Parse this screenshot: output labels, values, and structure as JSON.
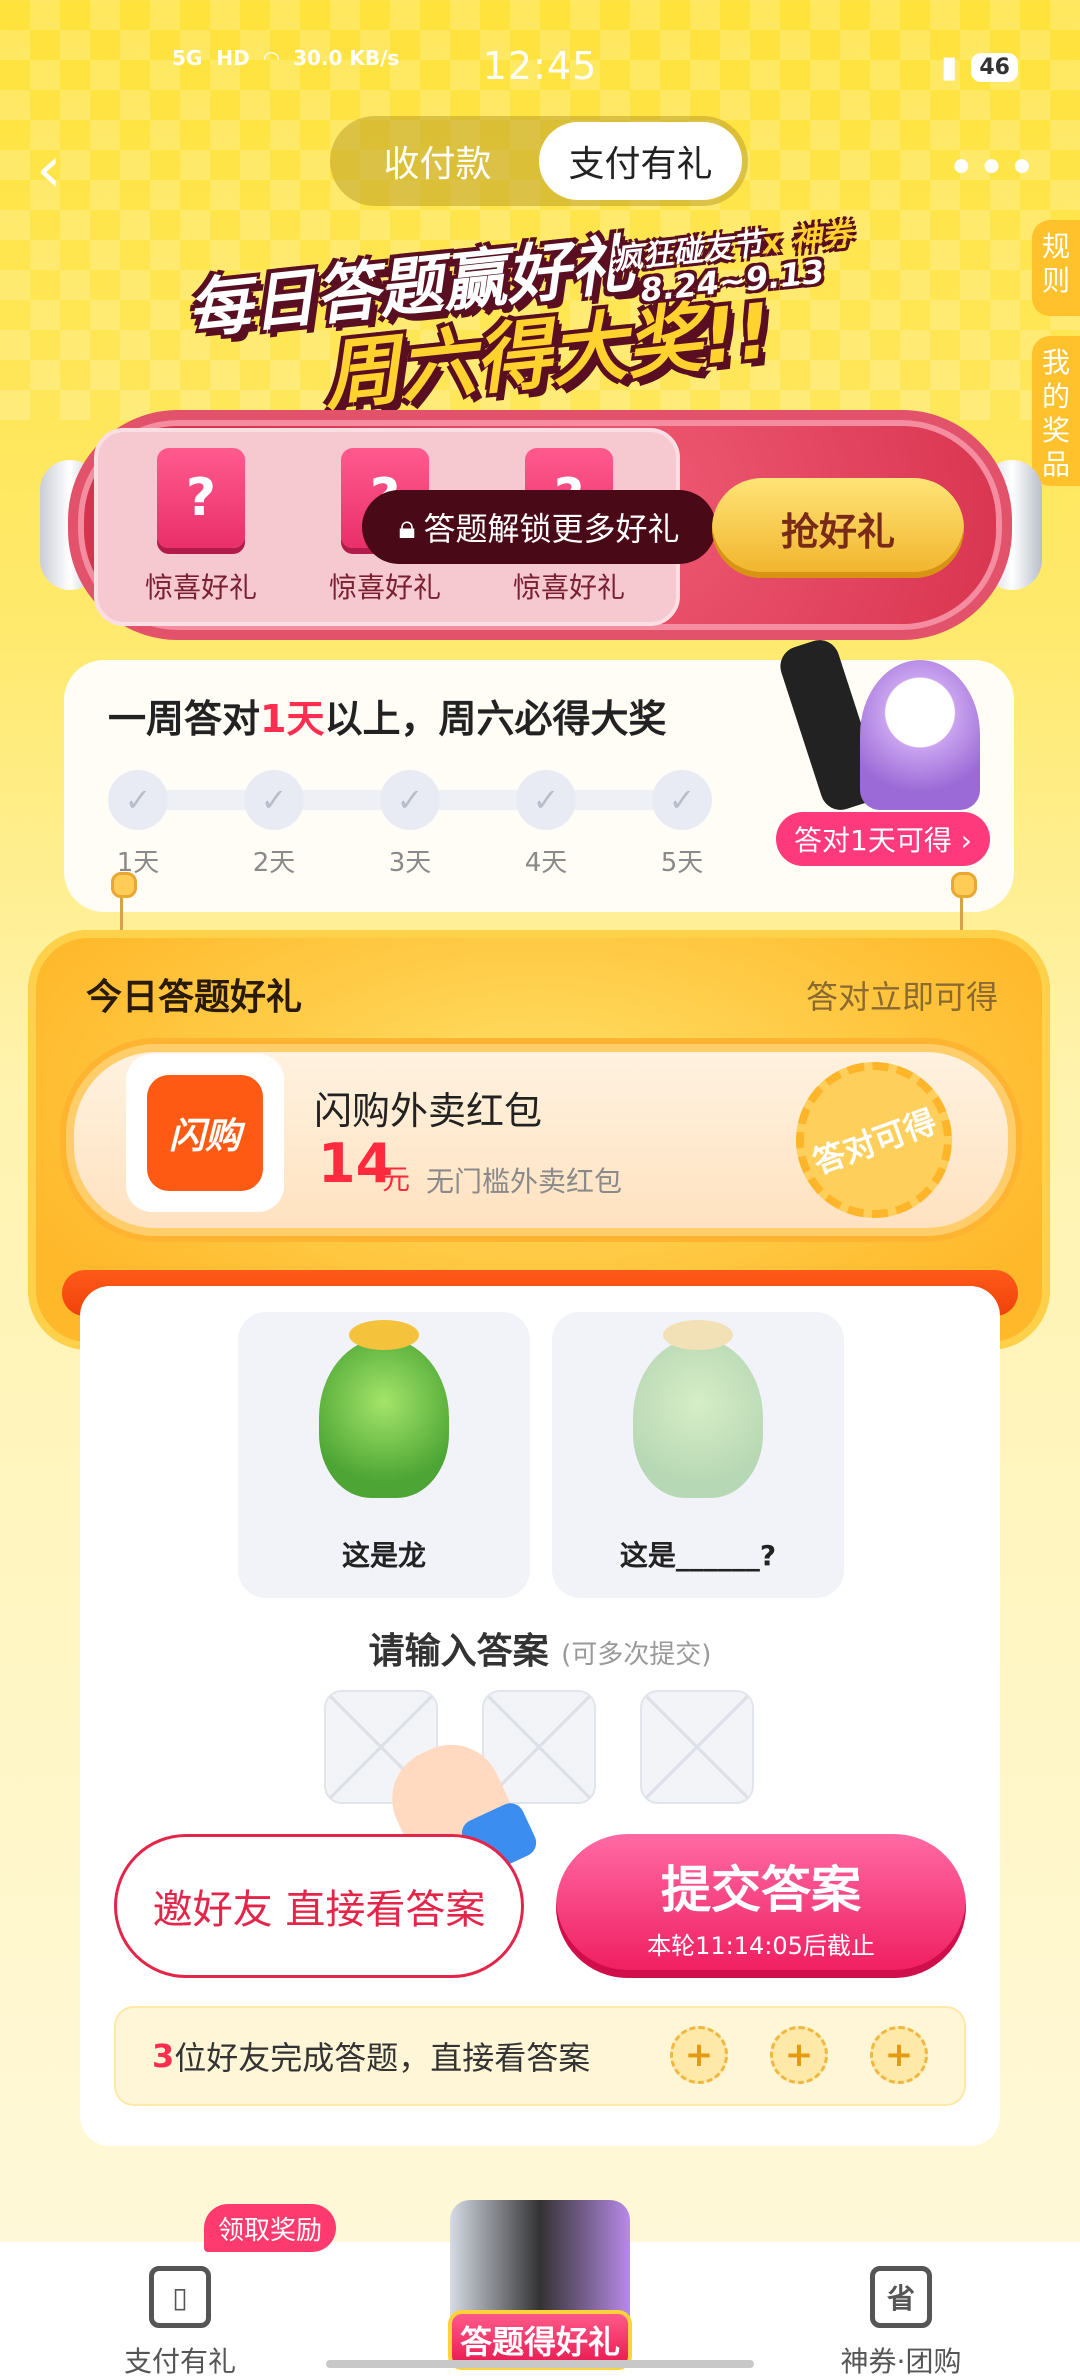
{
  "status_bar": {
    "network": "5G",
    "hd": "HD",
    "speed": "30.0 KB/s",
    "time": "12:45",
    "battery": "46"
  },
  "header": {
    "tabs": [
      {
        "label": "收付款",
        "active": false
      },
      {
        "label": "支付有礼",
        "active": true
      }
    ],
    "side_tabs": [
      "规则",
      "我的奖品"
    ]
  },
  "banner": {
    "line1": "每日答题赢好礼",
    "line2": "周六得大奖!!",
    "brand": "疯狂碰友节",
    "brand_sub": "x 神券",
    "date": "8.24~9.13"
  },
  "capsule": {
    "gifts": [
      {
        "label": "惊喜好礼"
      },
      {
        "label": "惊喜好礼"
      },
      {
        "label": "惊喜好礼"
      }
    ],
    "unlock_text": "答题解锁更多好礼",
    "grab_button": "抢好礼"
  },
  "week": {
    "title_pre": "一周答对",
    "title_hl": "1天",
    "title_post": "以上，周六必得大奖",
    "days": [
      "1天",
      "2天",
      "3天",
      "4天",
      "5天"
    ],
    "reward_tag": "答对1天可得 ›"
  },
  "today": {
    "title": "今日答题好礼",
    "subtitle": "答对立即可得",
    "coupon": {
      "brand": "闪购",
      "name": "闪购外卖红包",
      "amount": "14",
      "unit": "元",
      "desc": "无门槛外卖红包",
      "stamp": "答对可得"
    }
  },
  "question": {
    "cards": [
      {
        "caption": "这是龙"
      },
      {
        "caption": "这是______?"
      }
    ],
    "prompt": "请输入答案",
    "hint": "(可多次提交)",
    "invite_button": "邀好友 直接看答案",
    "submit_title": "提交答案",
    "submit_sub": "本轮11:14:05后截止",
    "friends_count": "3",
    "friends_text": "位好友完成答题，直接看答案"
  },
  "tabbar": {
    "left_label": "支付有礼",
    "left_badge": "领取奖励",
    "center_label": "答题得好礼",
    "right_label": "神券·团购",
    "right_icon": "省"
  },
  "colors": {
    "accent": "#ff2d4f",
    "yellow": "#ffe23a",
    "submit": "#ef1b5e"
  }
}
